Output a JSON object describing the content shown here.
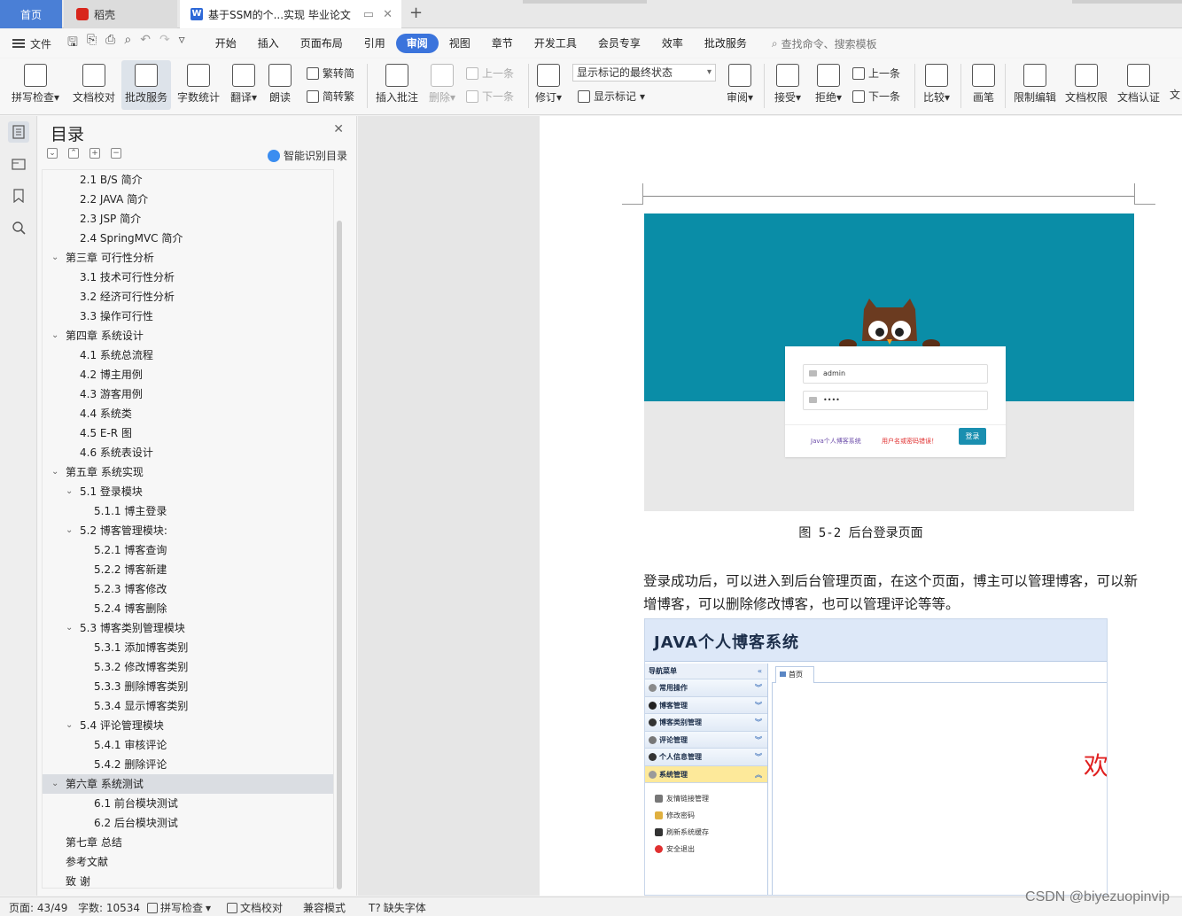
{
  "tabs": {
    "home": "首页",
    "daoke": "稻壳",
    "doc": "基于SSM的个...实现 毕业论文"
  },
  "menubar": {
    "file": "文件",
    "items": [
      "开始",
      "插入",
      "页面布局",
      "引用",
      "审阅",
      "视图",
      "章节",
      "开发工具",
      "会员专享",
      "效率",
      "批改服务"
    ],
    "active": "审阅",
    "search_placeholder": "查找命令、搜索模板"
  },
  "ribbon": {
    "spell": "拼写检查",
    "doc_check": "文档校对",
    "revise_service": "批改服务",
    "word_count": "字数统计",
    "translate": "翻译",
    "read_aloud": "朗读",
    "trad": "繁转简",
    "simp": "简转繁",
    "insert_comment": "插入批注",
    "delete": "删除",
    "prev_comment": "上一条",
    "next_comment": "下一条",
    "track": "修订",
    "markup_state": "显示标记的最终状态",
    "show_markup": "显示标记",
    "review_pane": "审阅",
    "accept": "接受",
    "reject": "拒绝",
    "prev_change": "上一条",
    "next_change": "下一条",
    "compare": "比较",
    "pen": "画笔",
    "restrict_edit": "限制编辑",
    "doc_rights": "文档权限",
    "doc_cert": "文档认证",
    "more": "文"
  },
  "toc": {
    "title": "目录",
    "ai_label": "智能识别目录",
    "items": [
      {
        "text": "2.1 B/S  简介",
        "level": 2
      },
      {
        "text": "2.2 JAVA  简介",
        "level": 2
      },
      {
        "text": "2.3 JSP  简介",
        "level": 2
      },
      {
        "text": "2.4 SpringMVC 简介",
        "level": 2
      },
      {
        "text": "第三章    可行性分析",
        "level": 1,
        "caret": true
      },
      {
        "text": "3.1  技术可行性分析",
        "level": 2
      },
      {
        "text": "3.2  经济可行性分析",
        "level": 2
      },
      {
        "text": "3.3  操作可行性",
        "level": 2
      },
      {
        "text": "第四章    系统设计",
        "level": 1,
        "caret": true
      },
      {
        "text": "4.1  系统总流程",
        "level": 2
      },
      {
        "text": "4.2  博主用例",
        "level": 2
      },
      {
        "text": "4.3  游客用例",
        "level": 2
      },
      {
        "text": "4.4  系统类",
        "level": 2
      },
      {
        "text": "4.5 E-R 图",
        "level": 2
      },
      {
        "text": "4.6  系统表设计",
        "level": 2
      },
      {
        "text": "第五章    系统实现",
        "level": 1,
        "caret": true
      },
      {
        "text": "5.1  登录模块",
        "level": 2,
        "caret": true
      },
      {
        "text": "5.1.1  博主登录",
        "level": 3
      },
      {
        "text": "5.2  博客管理模块:",
        "level": 2,
        "caret": true
      },
      {
        "text": "5.2.1  博客查询",
        "level": 3
      },
      {
        "text": "5.2.2  博客新建",
        "level": 3
      },
      {
        "text": "5.2.3  博客修改",
        "level": 3
      },
      {
        "text": "5.2.4  博客删除",
        "level": 3
      },
      {
        "text": "5.3  博客类别管理模块",
        "level": 2,
        "caret": true
      },
      {
        "text": "5.3.1  添加博客类别",
        "level": 3
      },
      {
        "text": "5.3.2  修改博客类别",
        "level": 3
      },
      {
        "text": "5.3.3  删除博客类别",
        "level": 3
      },
      {
        "text": "5.3.4  显示博客类别",
        "level": 3
      },
      {
        "text": "5.4  评论管理模块",
        "level": 2,
        "caret": true
      },
      {
        "text": "5.4.1  审核评论",
        "level": 3
      },
      {
        "text": "5.4.2  删除评论",
        "level": 3
      },
      {
        "text": "第六章    系统测试",
        "level": 1,
        "caret": true,
        "selected": true
      },
      {
        "text": "6.1  前台模块测试",
        "level": 3
      },
      {
        "text": "6.2  后台模块测试",
        "level": 3
      },
      {
        "text": "第七章  总结",
        "level": 1
      },
      {
        "text": "参考文献",
        "level": 1
      },
      {
        "text": "致    谢",
        "level": 1
      }
    ]
  },
  "document": {
    "login_figure": {
      "username": "admin",
      "password": "••••",
      "system_name": "Java个人博客系统",
      "error": "用户名或密码错误！",
      "login_button": "登录"
    },
    "caption": "图 5-2 后台登录页面",
    "paragraph": "登录成功后，可以进入到后台管理页面，在这个页面，博主可以管理博客，可以新增博客，可以删除修改博客，也可以管理评论等等。",
    "admin_figure": {
      "title": "JAVA个人博客系统",
      "nav_header": "导航菜单",
      "nav_items": [
        "常用操作",
        "博客管理",
        "博客类别管理",
        "评论管理",
        "个人信息管理",
        "系统管理"
      ],
      "sub_items": [
        "友情链接管理",
        "修改密码",
        "刷新系统缓存",
        "安全退出"
      ],
      "home_tab": "首页",
      "welcome": "欢"
    }
  },
  "status": {
    "page": "页面: 43/49",
    "words": "字数: 10534",
    "spell": "拼写检查",
    "doc_check": "文档校对",
    "compat": "兼容模式",
    "missing_font": "缺失字体"
  },
  "watermark": "CSDN @biyezuopinvip"
}
